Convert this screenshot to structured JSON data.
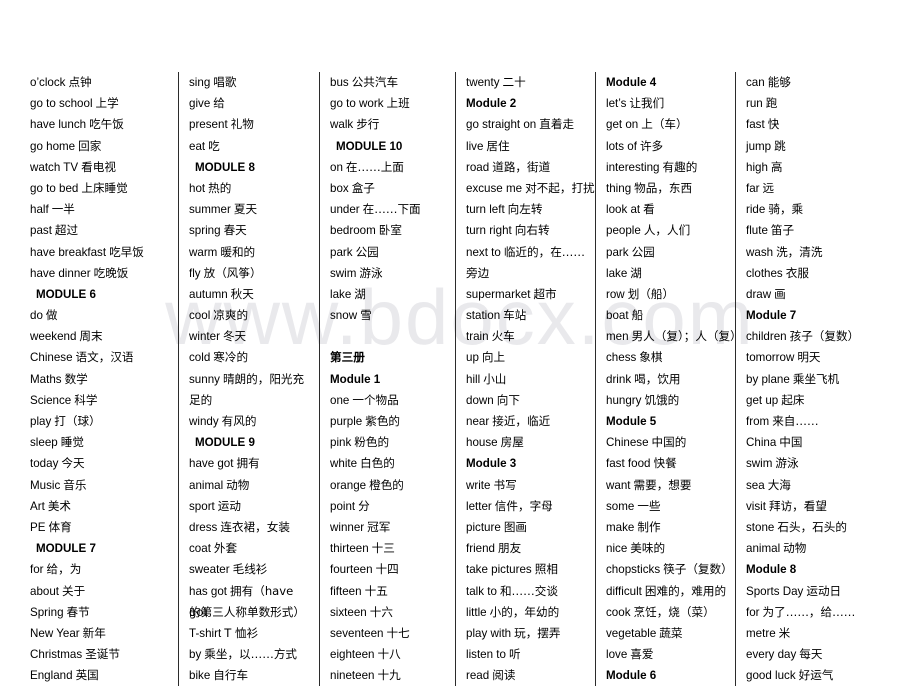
{
  "watermark": "www.bdocx.com",
  "columns": [
    {
      "id": "column-1",
      "entries": [
        {
          "type": "term",
          "en": "o’clock",
          "zh": "点钟"
        },
        {
          "type": "term",
          "en": "go to school",
          "zh": "上学"
        },
        {
          "type": "term",
          "en": "have lunch",
          "zh": "吃午饭"
        },
        {
          "type": "term",
          "en": "go home",
          "zh": "回家"
        },
        {
          "type": "term",
          "en": "watch TV",
          "zh": "看电视"
        },
        {
          "type": "term",
          "en": "go to bed",
          "zh": "上床睡觉"
        },
        {
          "type": "term",
          "en": "half",
          "zh": "一半"
        },
        {
          "type": "term",
          "en": "past",
          "zh": "超过"
        },
        {
          "type": "term",
          "en": "have breakfast",
          "zh": "吃早饭"
        },
        {
          "type": "term",
          "en": "have dinner",
          "zh": "吃晚饭"
        },
        {
          "type": "module",
          "label": "MODULE 6"
        },
        {
          "type": "term",
          "en": "do",
          "zh": "做"
        },
        {
          "type": "term",
          "en": "weekend",
          "zh": "周末"
        },
        {
          "type": "term",
          "en": "Chinese",
          "zh": "语文，汉语"
        },
        {
          "type": "term",
          "en": "Maths",
          "zh": "数学"
        },
        {
          "type": "term",
          "en": "Science",
          "zh": "科学"
        },
        {
          "type": "term",
          "en": "play",
          "zh": "打（球）"
        },
        {
          "type": "term",
          "en": "sleep",
          "zh": "睡觉"
        },
        {
          "type": "term",
          "en": "today",
          "zh": "今天"
        },
        {
          "type": "term",
          "en": "Music",
          "zh": "音乐"
        },
        {
          "type": "term",
          "en": "Art",
          "zh": "美术"
        },
        {
          "type": "term",
          "en": "PE",
          "zh": "体育"
        },
        {
          "type": "module",
          "label": "MODULE 7"
        },
        {
          "type": "term",
          "en": "for",
          "zh": "给，为"
        },
        {
          "type": "term",
          "en": "about",
          "zh": "关于"
        },
        {
          "type": "term",
          "en": "Spring",
          "zh": "春节"
        },
        {
          "type": "term",
          "en": "New Year",
          "zh": "新年"
        },
        {
          "type": "term",
          "en": "Christmas",
          "zh": "圣诞节"
        },
        {
          "type": "term",
          "en": "England",
          "zh": "英国"
        }
      ]
    },
    {
      "id": "column-2",
      "entries": [
        {
          "type": "term",
          "en": "sing",
          "zh": "唱歌"
        },
        {
          "type": "term",
          "en": "give",
          "zh": "给"
        },
        {
          "type": "term",
          "en": "present",
          "zh": "礼物"
        },
        {
          "type": "term",
          "en": "eat",
          "zh": "吃"
        },
        {
          "type": "module",
          "label": "MODULE 8"
        },
        {
          "type": "term",
          "en": "hot",
          "zh": "热的"
        },
        {
          "type": "term",
          "en": "summer",
          "zh": "夏天"
        },
        {
          "type": "term",
          "en": "spring",
          "zh": "春天"
        },
        {
          "type": "term",
          "en": "warm",
          "zh": "暖和的"
        },
        {
          "type": "term",
          "en": "fly",
          "zh": "放（风筝）"
        },
        {
          "type": "term",
          "en": "autumn",
          "zh": "秋天"
        },
        {
          "type": "term",
          "en": "cool",
          "zh": "凉爽的"
        },
        {
          "type": "term",
          "en": "winter",
          "zh": "冬天"
        },
        {
          "type": "term",
          "en": "cold",
          "zh": "寒冷的"
        },
        {
          "type": "term",
          "en": "sunny",
          "zh": "晴朗的，阳光充",
          "wrap": true
        },
        {
          "type": "cont",
          "zh": "足的"
        },
        {
          "type": "term",
          "en": "windy",
          "zh": "有风的"
        },
        {
          "type": "module",
          "label": "MODULE 9"
        },
        {
          "type": "term",
          "en": "have got",
          "zh": "拥有"
        },
        {
          "type": "term",
          "en": "animal",
          "zh": "动物"
        },
        {
          "type": "term",
          "en": "sport",
          "zh": "运动"
        },
        {
          "type": "term",
          "en": "dress",
          "zh": "连衣裙，女装"
        },
        {
          "type": "term",
          "en": "coat",
          "zh": "外套"
        },
        {
          "type": "term",
          "en": "sweater",
          "zh": "毛线衫"
        },
        {
          "type": "term",
          "en": "has got",
          "zh": "拥有（have got",
          "wrap": true
        },
        {
          "type": "cont",
          "zh": "的第三人称单数形式）"
        },
        {
          "type": "term",
          "en": "T-shirt",
          "zh": "T 恤衫"
        },
        {
          "type": "term",
          "en": "by",
          "zh": "乘坐，以……方式"
        },
        {
          "type": "term",
          "en": "bike",
          "zh": "自行车"
        }
      ]
    },
    {
      "id": "column-3",
      "entries": [
        {
          "type": "term",
          "en": "bus",
          "zh": "公共汽车"
        },
        {
          "type": "term",
          "en": "go to work",
          "zh": "上班"
        },
        {
          "type": "term",
          "en": "walk",
          "zh": "步行"
        },
        {
          "type": "module",
          "label": "MODULE 10"
        },
        {
          "type": "term",
          "en": "on",
          "zh": "在……上面"
        },
        {
          "type": "term",
          "en": "box",
          "zh": "盒子"
        },
        {
          "type": "term",
          "en": "under",
          "zh": "在……下面"
        },
        {
          "type": "term",
          "en": "bedroom",
          "zh": "卧室"
        },
        {
          "type": "term",
          "en": "park",
          "zh": "公园"
        },
        {
          "type": "term",
          "en": "swim",
          "zh": "游泳"
        },
        {
          "type": "term",
          "en": "lake",
          "zh": "湖"
        },
        {
          "type": "term",
          "en": "snow",
          "zh": "雪"
        },
        {
          "type": "spacer"
        },
        {
          "type": "book",
          "label": "第三册"
        },
        {
          "type": "module2",
          "label": "Module 1"
        },
        {
          "type": "term",
          "en": "one",
          "zh": "一个物品"
        },
        {
          "type": "term",
          "en": "purple",
          "zh": "紫色的"
        },
        {
          "type": "term",
          "en": "pink",
          "zh": "粉色的"
        },
        {
          "type": "term",
          "en": "white",
          "zh": "白色的"
        },
        {
          "type": "term",
          "en": "orange",
          "zh": "橙色的"
        },
        {
          "type": "term",
          "en": "point",
          "zh": "分"
        },
        {
          "type": "term",
          "en": "winner",
          "zh": "冠军"
        },
        {
          "type": "term",
          "en": "thirteen",
          "zh": "十三"
        },
        {
          "type": "term",
          "en": "fourteen",
          "zh": "十四"
        },
        {
          "type": "term",
          "en": "fifteen",
          "zh": "十五"
        },
        {
          "type": "term",
          "en": "sixteen",
          "zh": "十六"
        },
        {
          "type": "term",
          "en": "seventeen",
          "zh": "十七"
        },
        {
          "type": "term",
          "en": "eighteen",
          "zh": "十八"
        },
        {
          "type": "term",
          "en": "nineteen",
          "zh": "十九"
        }
      ]
    },
    {
      "id": "column-4",
      "entries": [
        {
          "type": "term",
          "en": "twenty",
          "zh": "二十"
        },
        {
          "type": "module2",
          "label": "Module 2"
        },
        {
          "type": "term",
          "en": "go straight on",
          "zh": "直着走"
        },
        {
          "type": "term",
          "en": "live",
          "zh": "居住"
        },
        {
          "type": "term",
          "en": "road",
          "zh": "道路，街道"
        },
        {
          "type": "term",
          "en": "excuse me",
          "zh": "对不起，打扰"
        },
        {
          "type": "term",
          "en": "turn left",
          "zh": "向左转"
        },
        {
          "type": "term",
          "en": "turn right",
          "zh": "向右转"
        },
        {
          "type": "term",
          "en": "next to",
          "zh": "临近的，在……",
          "wrap": true
        },
        {
          "type": "cont",
          "zh": "旁边"
        },
        {
          "type": "term",
          "en": "supermarket",
          "zh": "超市"
        },
        {
          "type": "term",
          "en": "station",
          "zh": "车站"
        },
        {
          "type": "term",
          "en": "train",
          "zh": "火车"
        },
        {
          "type": "term",
          "en": "up",
          "zh": "向上"
        },
        {
          "type": "term",
          "en": "hill",
          "zh": "小山"
        },
        {
          "type": "term",
          "en": "down",
          "zh": "向下"
        },
        {
          "type": "term",
          "en": "near",
          "zh": "接近，临近"
        },
        {
          "type": "term",
          "en": "house",
          "zh": "房屋"
        },
        {
          "type": "module2",
          "label": "Module 3"
        },
        {
          "type": "term",
          "en": "write",
          "zh": "书写"
        },
        {
          "type": "term",
          "en": "letter",
          "zh": "信件，字母"
        },
        {
          "type": "term",
          "en": "picture",
          "zh": "图画"
        },
        {
          "type": "term",
          "en": "friend",
          "zh": "朋友"
        },
        {
          "type": "term",
          "en": "take pictures",
          "zh": "照相"
        },
        {
          "type": "term",
          "en": "talk to",
          "zh": "和……交谈"
        },
        {
          "type": "term",
          "en": "little",
          "zh": "小的，年幼的"
        },
        {
          "type": "term",
          "en": "play with",
          "zh": "玩，摆弄"
        },
        {
          "type": "term",
          "en": "listen to",
          "zh": "听"
        },
        {
          "type": "term",
          "en": "read",
          "zh": "阅读"
        }
      ]
    },
    {
      "id": "column-5",
      "entries": [
        {
          "type": "module2",
          "label": "Module 4"
        },
        {
          "type": "term",
          "en": "let’s",
          "zh": "让我们"
        },
        {
          "type": "term",
          "en": "get on",
          "zh": "上（车）"
        },
        {
          "type": "term",
          "en": "lots of",
          "zh": "许多"
        },
        {
          "type": "term",
          "en": "interesting",
          "zh": "有趣的"
        },
        {
          "type": "term",
          "en": "thing",
          "zh": "物品，东西"
        },
        {
          "type": "term",
          "en": "look at",
          "zh": "看"
        },
        {
          "type": "term",
          "en": "people",
          "zh": "人，人们"
        },
        {
          "type": "term",
          "en": "park",
          "zh": "公园"
        },
        {
          "type": "term",
          "en": "lake",
          "zh": "湖"
        },
        {
          "type": "term",
          "en": "row",
          "zh": "划（船）"
        },
        {
          "type": "term",
          "en": "boat",
          "zh": "船"
        },
        {
          "type": "term",
          "en": "men",
          "zh": "男人（复）；人（复）"
        },
        {
          "type": "term",
          "en": "chess",
          "zh": "象棋"
        },
        {
          "type": "term",
          "en": "drink",
          "zh": "喝，饮用"
        },
        {
          "type": "term",
          "en": "hungry",
          "zh": "饥饿的"
        },
        {
          "type": "module2",
          "label": "Module 5"
        },
        {
          "type": "term",
          "en": "Chinese",
          "zh": "中国的"
        },
        {
          "type": "term",
          "en": "fast food",
          "zh": "快餐"
        },
        {
          "type": "term",
          "en": "want",
          "zh": "需要，想要"
        },
        {
          "type": "term",
          "en": "some",
          "zh": "一些"
        },
        {
          "type": "term",
          "en": "make",
          "zh": "制作"
        },
        {
          "type": "term",
          "en": "nice",
          "zh": "美味的"
        },
        {
          "type": "term",
          "en": "chopsticks",
          "zh": "筷子（复数）"
        },
        {
          "type": "term",
          "en": "difficult",
          "zh": "困难的，难用的"
        },
        {
          "type": "term",
          "en": "cook",
          "zh": "烹饪，烧（菜）"
        },
        {
          "type": "term",
          "en": "vegetable",
          "zh": "蔬菜"
        },
        {
          "type": "term",
          "en": "love",
          "zh": "喜爱"
        },
        {
          "type": "module2",
          "label": "Module 6"
        }
      ]
    },
    {
      "id": "column-6",
      "entries": [
        {
          "type": "term",
          "en": "can",
          "zh": "能够"
        },
        {
          "type": "term",
          "en": "run",
          "zh": "跑"
        },
        {
          "type": "term",
          "en": "fast",
          "zh": "快"
        },
        {
          "type": "term",
          "en": "jump",
          "zh": "跳"
        },
        {
          "type": "term",
          "en": "high",
          "zh": "高"
        },
        {
          "type": "term",
          "en": "far",
          "zh": "远"
        },
        {
          "type": "term",
          "en": "ride",
          "zh": "骑，乘"
        },
        {
          "type": "term",
          "en": "flute",
          "zh": "笛子"
        },
        {
          "type": "term",
          "en": "wash",
          "zh": "洗，清洗"
        },
        {
          "type": "term",
          "en": "clothes",
          "zh": "衣服"
        },
        {
          "type": "term",
          "en": "draw",
          "zh": "画"
        },
        {
          "type": "module2",
          "label": "Module 7"
        },
        {
          "type": "term",
          "en": "children",
          "zh": "孩子（复数）"
        },
        {
          "type": "term",
          "en": "tomorrow",
          "zh": "明天"
        },
        {
          "type": "term",
          "en": "by plane",
          "zh": "乘坐飞机"
        },
        {
          "type": "term",
          "en": "get up",
          "zh": "起床"
        },
        {
          "type": "term",
          "en": "from",
          "zh": "来自……"
        },
        {
          "type": "term",
          "en": "China",
          "zh": "中国"
        },
        {
          "type": "term",
          "en": "swim",
          "zh": "游泳"
        },
        {
          "type": "term",
          "en": "sea",
          "zh": "大海"
        },
        {
          "type": "term",
          "en": "visit",
          "zh": "拜访，看望"
        },
        {
          "type": "term",
          "en": "stone",
          "zh": "石头，石头的"
        },
        {
          "type": "term",
          "en": "animal",
          "zh": "动物"
        },
        {
          "type": "module2",
          "label": "Module 8"
        },
        {
          "type": "term",
          "en": "Sports Day",
          "zh": "运动日"
        },
        {
          "type": "term",
          "en": "for",
          "zh": "为了……，给……"
        },
        {
          "type": "term",
          "en": "metre",
          "zh": "米"
        },
        {
          "type": "term",
          "en": "every day",
          "zh": "每天"
        },
        {
          "type": "term",
          "en": "good luck",
          "zh": "好运气"
        }
      ]
    }
  ]
}
